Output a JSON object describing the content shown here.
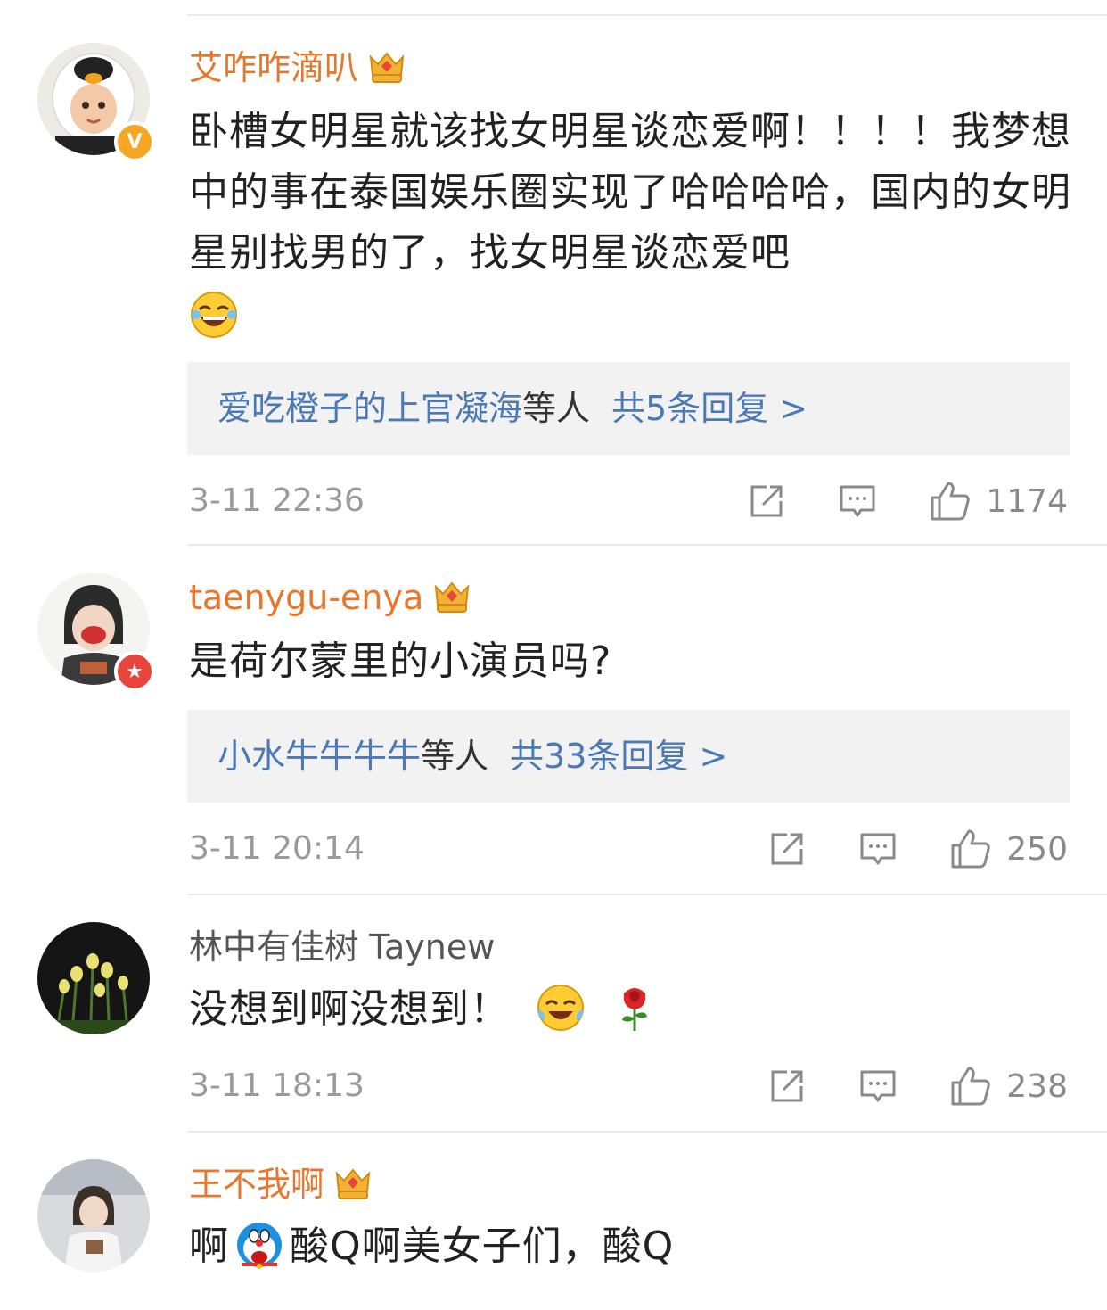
{
  "colors": {
    "vip_name": "#e8762b",
    "reply_link": "#4a79b5",
    "meta": "#9a9a9a",
    "reply_bg": "#f2f2f2"
  },
  "comments": [
    {
      "username": "艾咋咋滴叭",
      "crown_level": "7",
      "verified": "v-badge",
      "text": "卧槽女明星就该找女明星谈恋爱啊！！！！我梦想中的事在泰国娱乐圈实现了哈哈哈哈，国内的女明星别找男的了，找女明星谈恋爱吧",
      "emojis": [
        "laughing-emoji"
      ],
      "reply_names": "爱吃橙子的上官凝海",
      "reply_suffix": "等人",
      "reply_count": "共5条回复 >",
      "time": "3-11 22:36",
      "likes": "1174"
    },
    {
      "username": "taenygu-enya",
      "crown_level": "7",
      "verified": "star-badge",
      "text": "是荷尔蒙里的小演员吗?",
      "reply_names": "小水牛牛牛牛",
      "reply_suffix": "等人",
      "reply_count": "共33条回复 >",
      "time": "3-11 20:14",
      "likes": "250"
    },
    {
      "username": "林中有佳树 Taynew",
      "text": "没想到啊没想到！",
      "emojis": [
        "tears-of-joy-emoji",
        "rose-emoji"
      ],
      "time": "3-11 18:13",
      "likes": "238"
    },
    {
      "username": "王不我啊",
      "crown_level": "6",
      "text_before": "啊",
      "text_after": "酸Q啊美女子们，酸Q",
      "emojis": [
        "doraemon-emoji"
      ]
    }
  ]
}
